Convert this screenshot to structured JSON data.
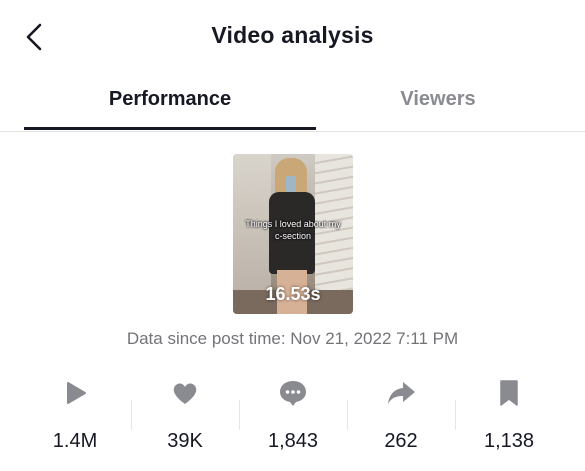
{
  "header": {
    "title": "Video analysis"
  },
  "tabs": [
    {
      "label": "Performance",
      "active": true
    },
    {
      "label": "Viewers",
      "active": false
    }
  ],
  "video": {
    "caption": "Things I loved about my c-section",
    "duration": "16.53s"
  },
  "data_since": "Data since post time: Nov 21, 2022 7:11 PM",
  "stats": [
    {
      "icon": "play-icon",
      "value": "1.4M"
    },
    {
      "icon": "heart-icon",
      "value": "39K"
    },
    {
      "icon": "comment-icon",
      "value": "1,843"
    },
    {
      "icon": "share-icon",
      "value": "262"
    },
    {
      "icon": "bookmark-icon",
      "value": "1,138"
    }
  ],
  "colors": {
    "text": "#161823",
    "muted": "#8a8b91",
    "icon": "#8a8b91",
    "divider": "#e3e3e4"
  }
}
